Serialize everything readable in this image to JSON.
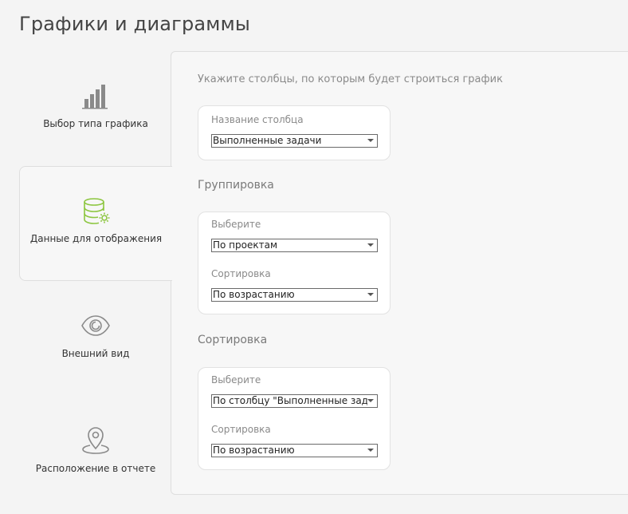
{
  "page": {
    "title": "Графики и диаграммы"
  },
  "tabs": [
    {
      "label": "Выбор типа графика",
      "icon": "bar-chart-icon"
    },
    {
      "label": "Данные для отображения",
      "icon": "database-settings-icon",
      "active": true
    },
    {
      "label": "Внешний вид",
      "icon": "eye-icon"
    },
    {
      "label": "Расположение в отчете",
      "icon": "map-pin-icon"
    }
  ],
  "hint": "Укажите столбцы, по которым будет строиться график",
  "column": {
    "label": "Название столбца",
    "value": "Выполненные задачи"
  },
  "grouping": {
    "title": "Группировка",
    "select_label": "Выберите",
    "select_value": "По проектам",
    "sort_label": "Сортировка",
    "sort_value": "По возрастанию"
  },
  "sorting": {
    "title": "Сортировка",
    "select_label": "Выберите",
    "select_value": "По столбцу \"Выполненные задачи\"",
    "sort_label": "Сортировка",
    "sort_value": "По возрастанию"
  },
  "colors": {
    "accent": "#8cc63f",
    "icon_gray": "#8a8a8a"
  }
}
